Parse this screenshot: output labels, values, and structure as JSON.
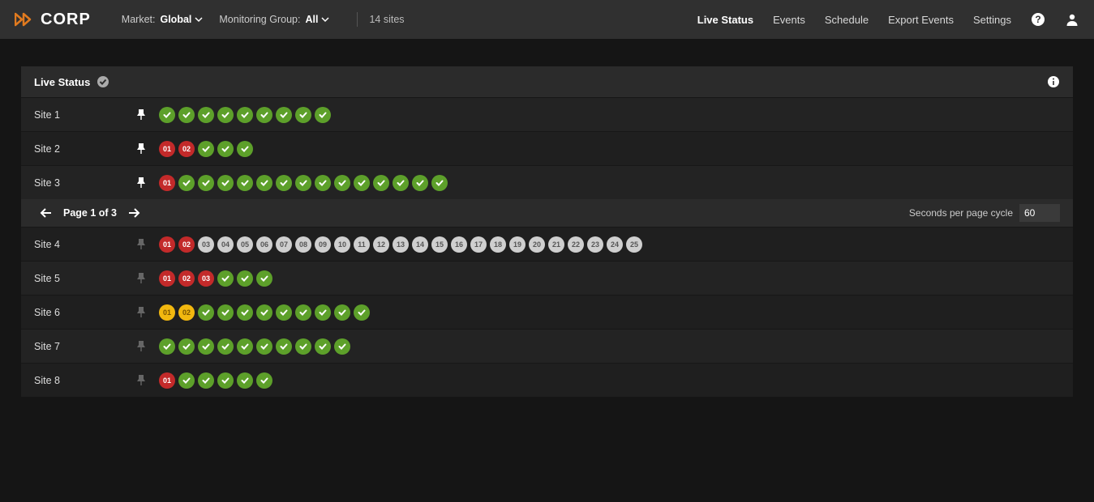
{
  "brand": "CORP",
  "filters": {
    "market_label": "Market:",
    "market_value": "Global",
    "group_label": "Monitoring Group:",
    "group_value": "All",
    "sitecount": "14 sites"
  },
  "nav": {
    "live_status": "Live Status",
    "events": "Events",
    "schedule": "Schedule",
    "export": "Export Events",
    "settings": "Settings"
  },
  "panel": {
    "title": "Live Status",
    "page_label": "Page 1 of 3",
    "cycle_label": "Seconds per page cycle",
    "cycle_value": "60"
  },
  "sites": [
    {
      "name": "Site 1",
      "pinned": true,
      "dots": [
        {
          "s": "ok"
        },
        {
          "s": "ok"
        },
        {
          "s": "ok"
        },
        {
          "s": "ok"
        },
        {
          "s": "ok"
        },
        {
          "s": "ok"
        },
        {
          "s": "ok"
        },
        {
          "s": "ok"
        },
        {
          "s": "ok"
        }
      ]
    },
    {
      "name": "Site 2",
      "pinned": true,
      "dots": [
        {
          "s": "err",
          "n": "01"
        },
        {
          "s": "err",
          "n": "02"
        },
        {
          "s": "ok"
        },
        {
          "s": "ok"
        },
        {
          "s": "ok"
        }
      ]
    },
    {
      "name": "Site 3",
      "pinned": true,
      "dots": [
        {
          "s": "err",
          "n": "01"
        },
        {
          "s": "ok"
        },
        {
          "s": "ok"
        },
        {
          "s": "ok"
        },
        {
          "s": "ok"
        },
        {
          "s": "ok"
        },
        {
          "s": "ok"
        },
        {
          "s": "ok"
        },
        {
          "s": "ok"
        },
        {
          "s": "ok"
        },
        {
          "s": "ok"
        },
        {
          "s": "ok"
        },
        {
          "s": "ok"
        },
        {
          "s": "ok"
        },
        {
          "s": "ok"
        }
      ]
    },
    {
      "name": "Site 4",
      "pinned": false,
      "dots": [
        {
          "s": "err",
          "n": "01"
        },
        {
          "s": "err",
          "n": "02"
        },
        {
          "s": "inactive",
          "n": "03"
        },
        {
          "s": "inactive",
          "n": "04"
        },
        {
          "s": "inactive",
          "n": "05"
        },
        {
          "s": "inactive",
          "n": "06"
        },
        {
          "s": "inactive",
          "n": "07"
        },
        {
          "s": "inactive",
          "n": "08"
        },
        {
          "s": "inactive",
          "n": "09"
        },
        {
          "s": "inactive",
          "n": "10"
        },
        {
          "s": "inactive",
          "n": "11"
        },
        {
          "s": "inactive",
          "n": "12"
        },
        {
          "s": "inactive",
          "n": "13"
        },
        {
          "s": "inactive",
          "n": "14"
        },
        {
          "s": "inactive",
          "n": "15"
        },
        {
          "s": "inactive",
          "n": "16"
        },
        {
          "s": "inactive",
          "n": "17"
        },
        {
          "s": "inactive",
          "n": "18"
        },
        {
          "s": "inactive",
          "n": "19"
        },
        {
          "s": "inactive",
          "n": "20"
        },
        {
          "s": "inactive",
          "n": "21"
        },
        {
          "s": "inactive",
          "n": "22"
        },
        {
          "s": "inactive",
          "n": "23"
        },
        {
          "s": "inactive",
          "n": "24"
        },
        {
          "s": "inactive",
          "n": "25"
        }
      ]
    },
    {
      "name": "Site 5",
      "pinned": false,
      "dots": [
        {
          "s": "err",
          "n": "01"
        },
        {
          "s": "err",
          "n": "02"
        },
        {
          "s": "err",
          "n": "03"
        },
        {
          "s": "ok"
        },
        {
          "s": "ok"
        },
        {
          "s": "ok"
        }
      ]
    },
    {
      "name": "Site 6",
      "pinned": false,
      "dots": [
        {
          "s": "warn",
          "n": "01"
        },
        {
          "s": "warn",
          "n": "02"
        },
        {
          "s": "ok"
        },
        {
          "s": "ok"
        },
        {
          "s": "ok"
        },
        {
          "s": "ok"
        },
        {
          "s": "ok"
        },
        {
          "s": "ok"
        },
        {
          "s": "ok"
        },
        {
          "s": "ok"
        },
        {
          "s": "ok"
        }
      ]
    },
    {
      "name": "Site 7",
      "pinned": false,
      "dots": [
        {
          "s": "ok"
        },
        {
          "s": "ok"
        },
        {
          "s": "ok"
        },
        {
          "s": "ok"
        },
        {
          "s": "ok"
        },
        {
          "s": "ok"
        },
        {
          "s": "ok"
        },
        {
          "s": "ok"
        },
        {
          "s": "ok"
        },
        {
          "s": "ok"
        }
      ]
    },
    {
      "name": "Site 8",
      "pinned": false,
      "dots": [
        {
          "s": "err",
          "n": "01"
        },
        {
          "s": "ok"
        },
        {
          "s": "ok"
        },
        {
          "s": "ok"
        },
        {
          "s": "ok"
        },
        {
          "s": "ok"
        }
      ]
    }
  ]
}
